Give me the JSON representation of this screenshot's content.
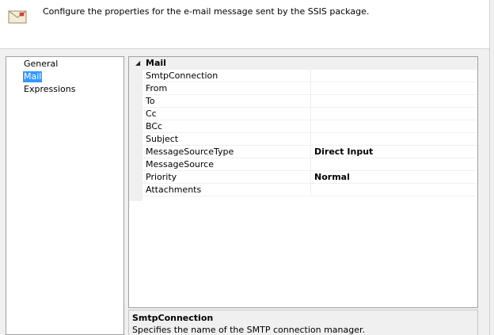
{
  "header": {
    "icon": "envelope-icon",
    "description": "Configure the properties for the e-mail message sent by the SSIS package."
  },
  "nav": {
    "items": [
      {
        "label": "General",
        "selected": false
      },
      {
        "label": "Mail",
        "selected": true
      },
      {
        "label": "Expressions",
        "selected": false
      }
    ]
  },
  "grid": {
    "category": "Mail",
    "category_expanded": true,
    "properties": [
      {
        "name": "SmtpConnection",
        "value": ""
      },
      {
        "name": "From",
        "value": ""
      },
      {
        "name": "To",
        "value": ""
      },
      {
        "name": "Cc",
        "value": ""
      },
      {
        "name": "BCc",
        "value": ""
      },
      {
        "name": "Subject",
        "value": ""
      },
      {
        "name": "MessageSourceType",
        "value": "Direct Input"
      },
      {
        "name": "MessageSource",
        "value": ""
      },
      {
        "name": "Priority",
        "value": "Normal"
      },
      {
        "name": "Attachments",
        "value": ""
      }
    ]
  },
  "description": {
    "title": "SmtpConnection",
    "text": "Specifies the name of the SMTP connection manager."
  },
  "colors": {
    "selection": "#3399ff",
    "window_bg": "#f0f0f0",
    "pane_border": "#a0a0a0"
  }
}
